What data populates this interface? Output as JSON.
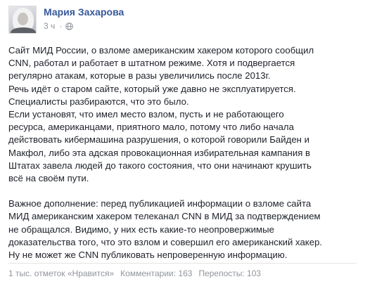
{
  "post": {
    "author": "Мария Захарова",
    "timestamp": "3 ч",
    "separator": "·",
    "privacy_icon": "globe-icon",
    "paragraphs": [
      "Сайт МИД России, о взломе американским хакером которого сообщил\nCNN, работал и работает в штатном режиме. Хотя и подвергается\nрегулярно атакам, которые в разы увеличились после 2013г.\nРечь идёт о старом сайте, который уже давно не эксплуатируется.\nСпециалисты разбираются, что это было.\nЕсли установят, что имел место взлом, пусть и не работающего\nресурса, американцами, приятного мало, потому что либо начала\nдействовать кибермашина разрушения, о которой говорили Байден и\nМакфол, либо эта адская провокационная избирательная кампания в\nШтатах завела людей до такого состояния, что они начинают крушить\nвсё на своём пути.",
      "Важное дополнение: перед публикацией информации о взломе сайта\nМИД американским хакером телеканал CNN в МИД за подтверждением\nне обращался. Видимо, у них есть какие-то неопровержимые\nдоказательства того, что это взлом и совершил его американский хакер.\nНу не может же CNN публиковать непроверенную информацию."
    ],
    "stats": {
      "likes": "1 тыс. отметок «Нравится»",
      "comments": "Комментарии: 163",
      "shares": "Перепосты: 103"
    }
  },
  "colors": {
    "author_link": "#365899",
    "text": "#1d2129",
    "meta": "#90949c"
  }
}
